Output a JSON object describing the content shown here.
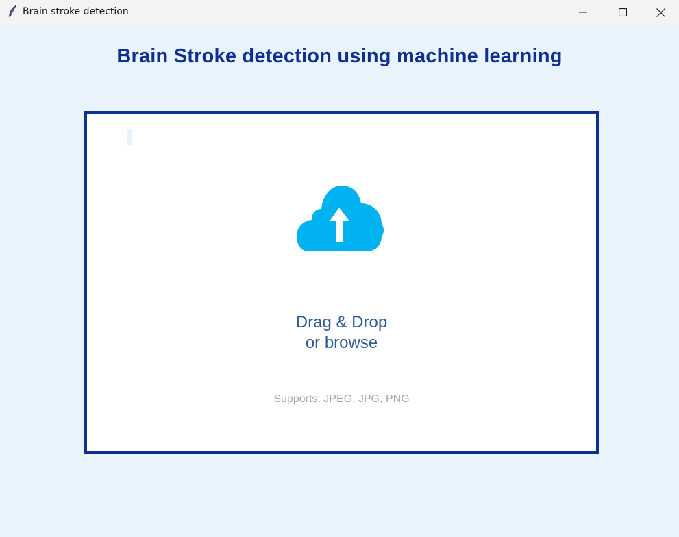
{
  "window": {
    "title": "Brain stroke detection",
    "icon": "feather-icon",
    "controls": [
      "minimize-icon",
      "maximize-icon",
      "close-icon"
    ]
  },
  "header": {
    "title": "Brain Stroke detection using machine learning"
  },
  "dropzone": {
    "icon": "cloud-upload-icon",
    "primary_line1": "Drag & Drop",
    "primary_line2": "or browse",
    "supports": "Supports: JPEG, JPG, PNG"
  },
  "colors": {
    "background": "#e8f3fb",
    "accent": "#0f3091",
    "cloud": "#00b2f0",
    "drag_text": "#2d5b94",
    "hint_text": "#a6a6a6"
  }
}
